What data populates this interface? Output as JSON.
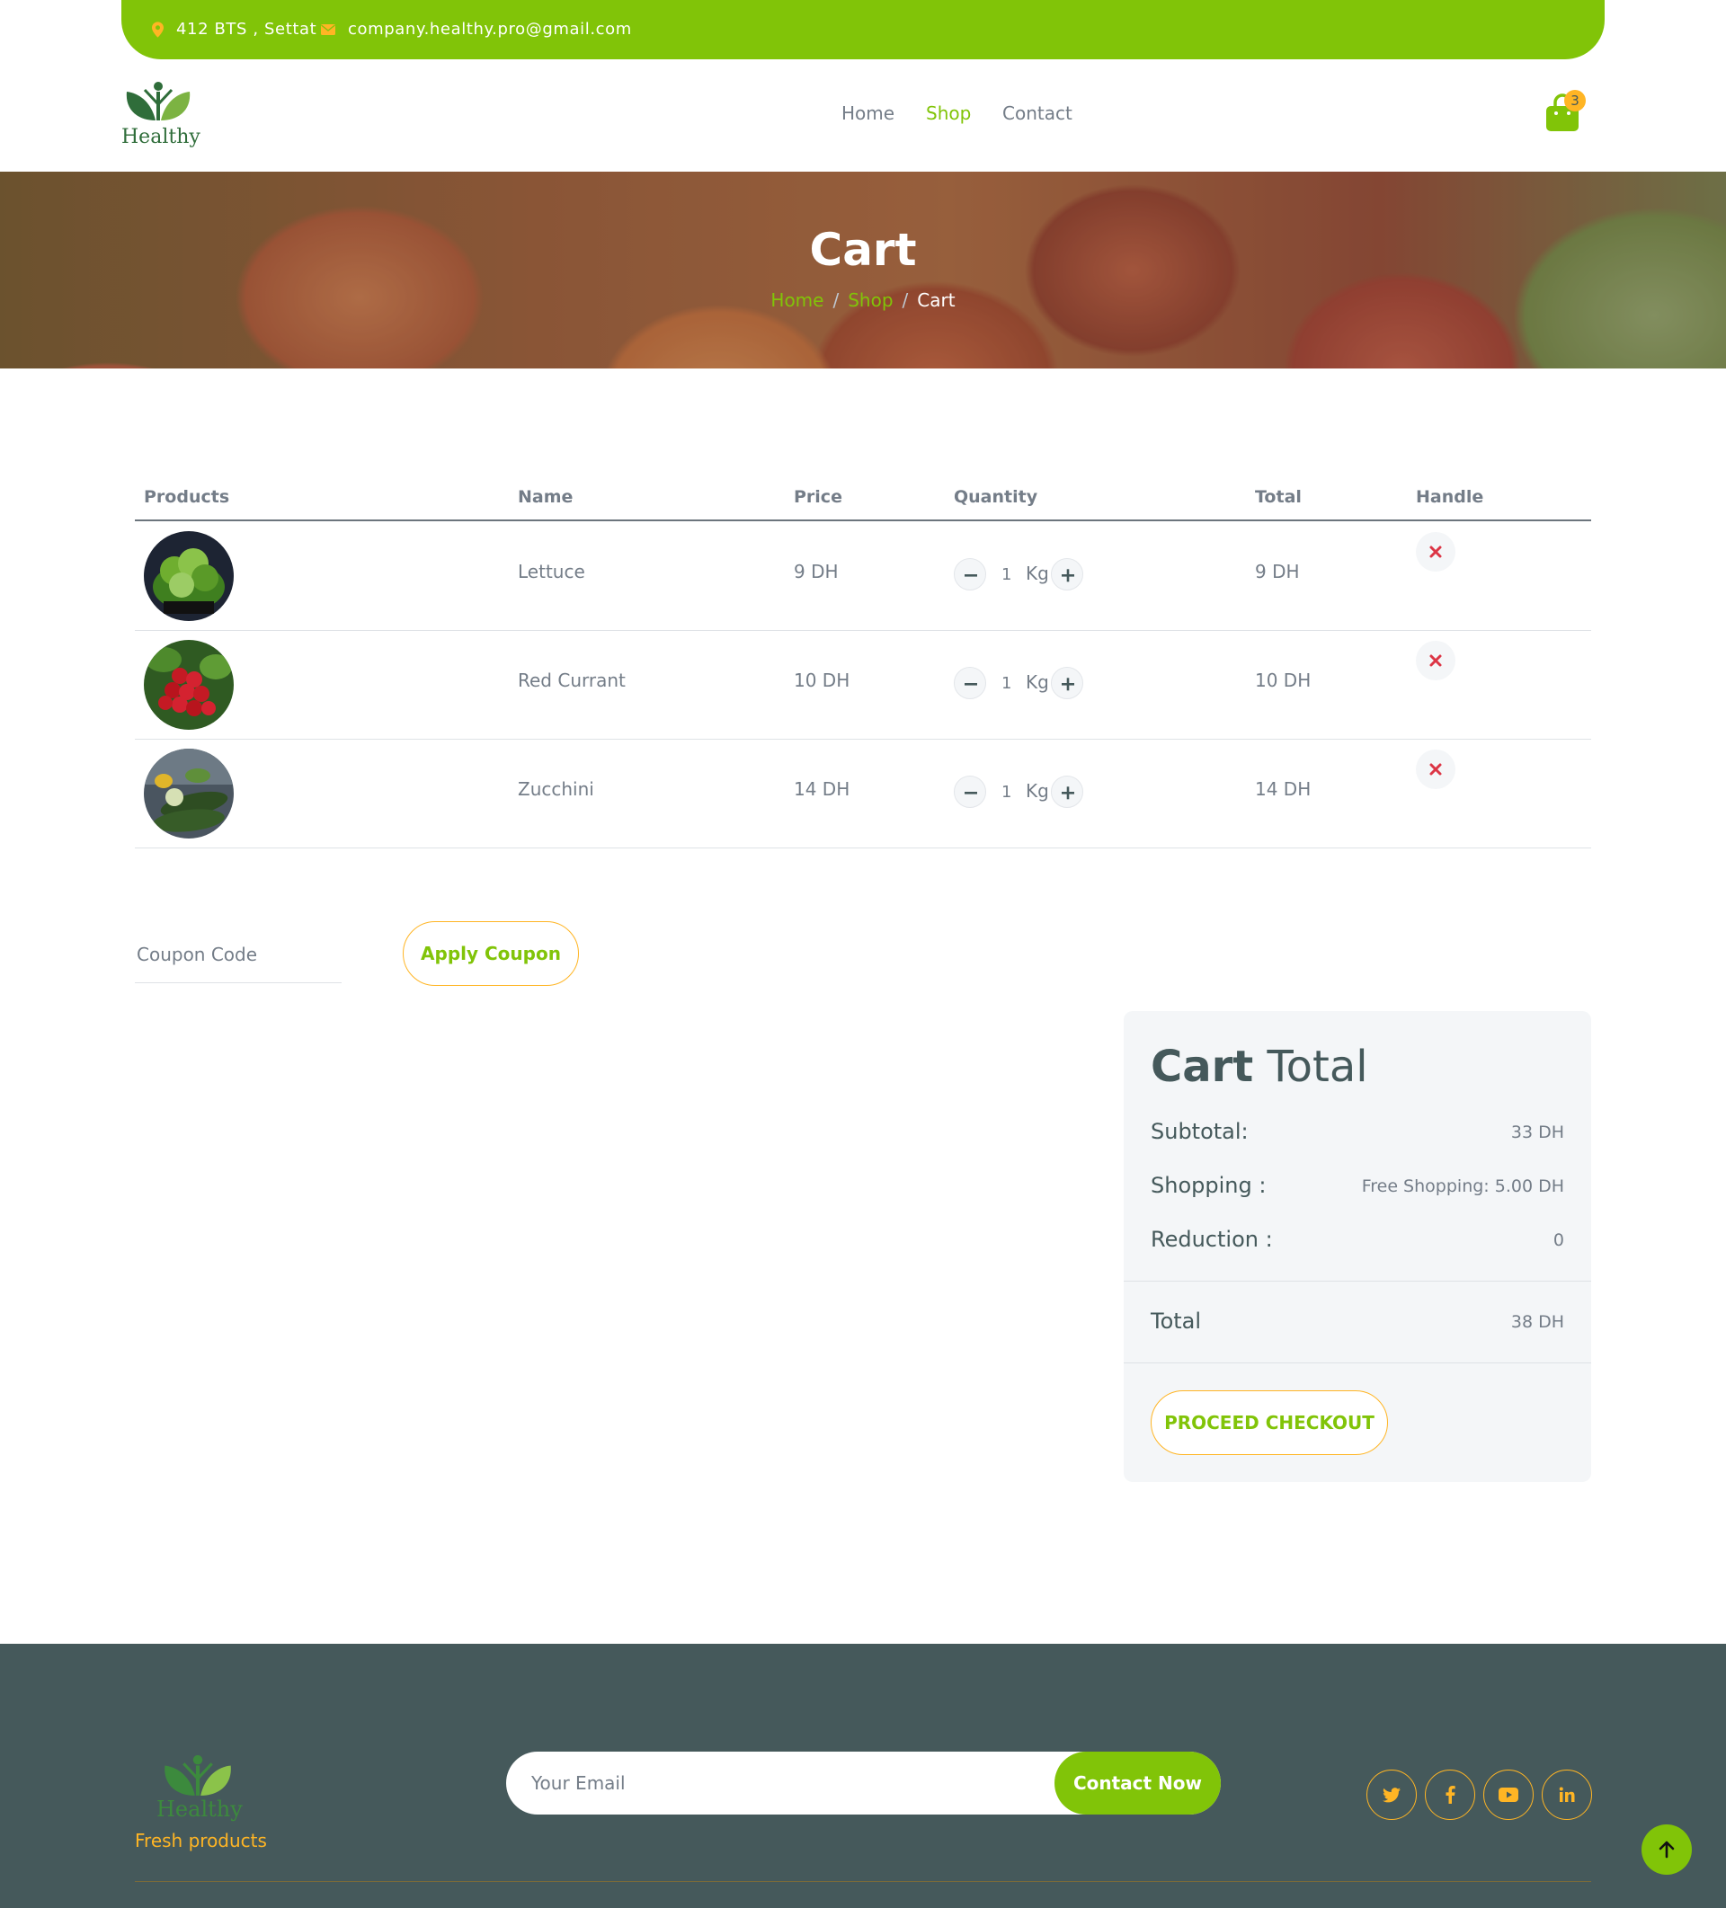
{
  "topbar": {
    "address": "412 BTS , Settat",
    "email": "company.healthy.pro@gmail.com",
    "address_icon": "map-pin-icon",
    "email_icon": "envelope-icon"
  },
  "navbar": {
    "brand": "Healthy",
    "links": [
      "Home",
      "Shop",
      "Contact"
    ],
    "active": "Shop",
    "cart_count": "3",
    "cart_icon": "shopping-bag-icon"
  },
  "hero": {
    "title": "Cart",
    "breadcrumb": [
      "Home",
      "Shop",
      "Cart"
    ]
  },
  "cart_table": {
    "headers": [
      "Products",
      "Name",
      "Price",
      "Quantity",
      "Total",
      "Handle"
    ],
    "rows": [
      {
        "name": "Lettuce",
        "price": "9 DH",
        "qty": "1",
        "unit": "Kg",
        "total": "9 DH"
      },
      {
        "name": "Red Currant",
        "price": "10 DH",
        "qty": "1",
        "unit": "Kg",
        "total": "10 DH"
      },
      {
        "name": "Zucchini",
        "price": "14 DH",
        "qty": "1",
        "unit": "Kg",
        "total": "14 DH"
      }
    ]
  },
  "coupon": {
    "placeholder": "Coupon Code",
    "apply_label": "Apply Coupon"
  },
  "cart_total": {
    "title_bold": "Cart",
    "title_rest": "Total",
    "subtotal_label": "Subtotal:",
    "subtotal_value": "33 DH",
    "shipping_label": "Shopping :",
    "shipping_value": "Free Shopping: 5.00 DH",
    "reduction_label": "Reduction :",
    "reduction_value": "0",
    "total_label": "Total",
    "total_value": "38 DH",
    "checkout_label": "PROCEED CHECKOUT"
  },
  "footer": {
    "brand": "Healthy",
    "tagline": "Fresh products",
    "email_placeholder": "Your Email",
    "contact_label": "Contact Now",
    "social_icons": [
      "twitter-icon",
      "facebook-icon",
      "youtube-icon",
      "linkedin-icon"
    ]
  },
  "colors": {
    "primary": "#81c408",
    "secondary": "#ffb524",
    "dark": "#45595b",
    "danger": "#dc3545"
  }
}
